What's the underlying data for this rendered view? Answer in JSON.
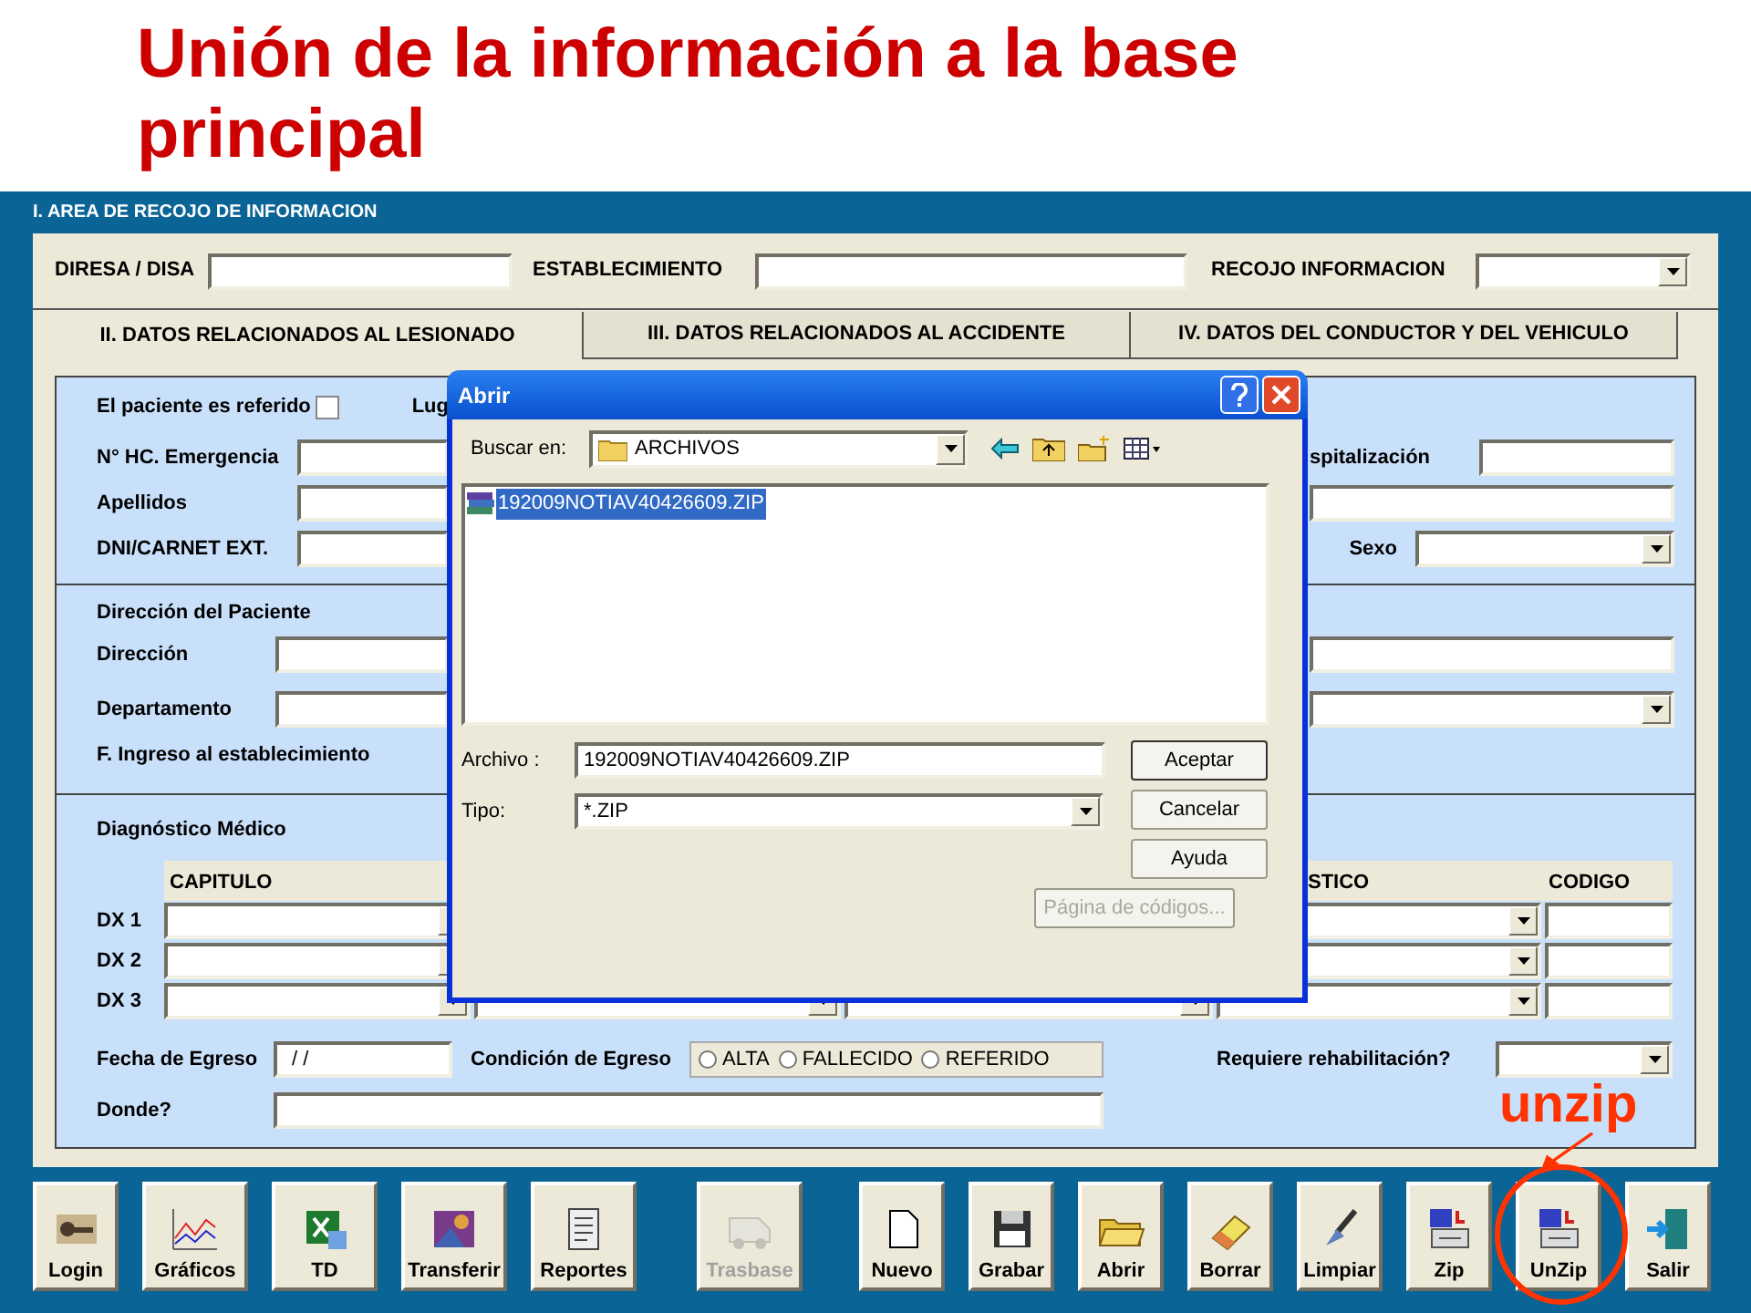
{
  "slide_title": "Unión de la información a la base principal",
  "form": {
    "section_title": "I. AREA DE RECOJO DE INFORMACION",
    "header_fields": [
      {
        "label": "DIRESA / DISA",
        "kind": "text"
      },
      {
        "label": "ESTABLECIMIENTO",
        "kind": "text"
      },
      {
        "label": "RECOJO INFORMACION",
        "kind": "combo"
      }
    ],
    "tabs": [
      {
        "label": "II. DATOS RELACIONADOS AL LESIONADO",
        "selected": true
      },
      {
        "label": "III. DATOS RELACIONADOS AL ACCIDENTE",
        "selected": false
      },
      {
        "label": "IV. DATOS DEL CONDUCTOR Y DEL VEHICULO",
        "selected": false
      }
    ],
    "patient": {
      "referred_label": "El paciente es referido",
      "referred_checked": false,
      "place_label": "Lug",
      "record_label": "N° HC. Emergencia",
      "hospital_label": "spitalización",
      "surname_label": "Apellidos",
      "id_label": "DNI/CARNET EXT.",
      "sex_label": "Sexo"
    },
    "address": {
      "title": "Dirección del Paciente",
      "address_label": "Dirección",
      "department_label": "Departamento",
      "admission_label": "F. Ingreso al establecimiento"
    },
    "diagnosis": {
      "title": "Diagnóstico Médico",
      "columns": [
        "CAPITULO",
        "STICO",
        "CODIGO"
      ],
      "rows": [
        "DX 1",
        "DX 2",
        "DX 3"
      ],
      "discharge_date_label": "Fecha de Egreso",
      "discharge_date_value": "/ /",
      "condition_label": "Condición de Egreso",
      "conditions": [
        {
          "label": "ALTA",
          "selected": false
        },
        {
          "label": "FALLECIDO",
          "selected": false
        },
        {
          "label": "REFERIDO",
          "selected": false
        }
      ],
      "rehab_label": "Requiere rehabilitación?",
      "where_label": "Donde?"
    }
  },
  "dialog": {
    "title": "Abrir",
    "look_in_label": "Buscar en:",
    "look_in_value": "ARCHIVOS",
    "files": [
      {
        "name": "192009NOTIAV40426609.ZIP",
        "selected": true
      }
    ],
    "file_label": "Archivo :",
    "file_value": "192009NOTIAV40426609.ZIP",
    "type_label": "Tipo:",
    "type_value": "*.ZIP",
    "buttons": [
      {
        "label": "Aceptar",
        "disabled": false
      },
      {
        "label": "Cancelar",
        "disabled": false
      },
      {
        "label": "Ayuda",
        "disabled": false
      }
    ],
    "codepage_button": {
      "label": "Página de códigos...",
      "disabled": true
    }
  },
  "toolbar": {
    "left": [
      {
        "label": "Login",
        "disabled": false
      },
      {
        "label": "Gráficos",
        "disabled": false
      },
      {
        "label": "TD",
        "disabled": false
      },
      {
        "label": "Transferir",
        "disabled": false
      },
      {
        "label": "Reportes",
        "disabled": false
      }
    ],
    "middle": [
      {
        "label": "Trasbase",
        "disabled": true
      }
    ],
    "right": [
      {
        "label": "Nuevo",
        "disabled": false
      },
      {
        "label": "Grabar",
        "disabled": false
      },
      {
        "label": "Abrir",
        "disabled": false
      },
      {
        "label": "Borrar",
        "disabled": false
      },
      {
        "label": "Limpiar",
        "disabled": false
      },
      {
        "label": "Zip",
        "disabled": false
      },
      {
        "label": "UnZip",
        "disabled": false
      },
      {
        "label": "Salir",
        "disabled": false
      }
    ]
  },
  "annotation": {
    "label": "unzip"
  }
}
